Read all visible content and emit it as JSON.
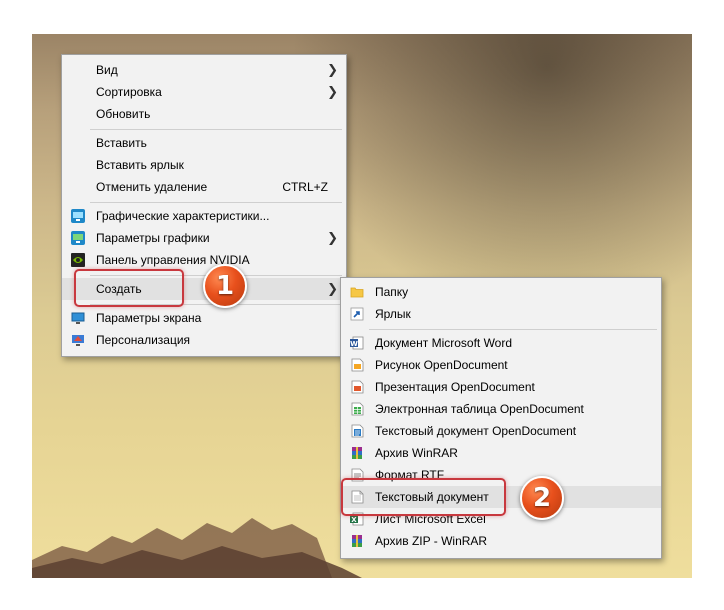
{
  "context_menu": {
    "items": [
      {
        "label": "Вид",
        "has_submenu": true
      },
      {
        "label": "Сортировка",
        "has_submenu": true
      },
      {
        "label": "Обновить"
      },
      {
        "label": "Вставить"
      },
      {
        "label": "Вставить ярлык"
      },
      {
        "label": "Отменить удаление",
        "shortcut": "CTRL+Z"
      },
      {
        "label": "Графические характеристики...",
        "icon": "intel-graphics-icon"
      },
      {
        "label": "Параметры графики",
        "icon": "intel-graphics-icon",
        "has_submenu": true
      },
      {
        "label": "Панель управления NVIDIA",
        "icon": "nvidia-icon"
      },
      {
        "label": "Создать",
        "has_submenu": true,
        "highlighted": true
      },
      {
        "label": "Параметры экрана",
        "icon": "display-icon"
      },
      {
        "label": "Персонализация",
        "icon": "personalization-icon"
      }
    ]
  },
  "submenu_create": {
    "items": [
      {
        "label": "Папку",
        "icon": "folder-icon"
      },
      {
        "label": "Ярлык",
        "icon": "shortcut-icon"
      },
      {
        "label": "Документ Microsoft Word",
        "icon": "word-icon"
      },
      {
        "label": "Рисунок OpenDocument",
        "icon": "odg-icon"
      },
      {
        "label": "Презентация OpenDocument",
        "icon": "odp-icon"
      },
      {
        "label": "Электронная таблица OpenDocument",
        "icon": "ods-icon"
      },
      {
        "label": "Текстовый документ OpenDocument",
        "icon": "odt-icon"
      },
      {
        "label": "Архив WinRAR",
        "icon": "winrar-icon"
      },
      {
        "label": "Формат RTF",
        "icon": "rtf-icon"
      },
      {
        "label": "Текстовый документ",
        "icon": "text-document-icon",
        "highlighted": true
      },
      {
        "label": "Лист Microsoft Excel",
        "icon": "excel-icon"
      },
      {
        "label": "Архив ZIP - WinRAR",
        "icon": "winrar-zip-icon"
      }
    ]
  },
  "annotations": {
    "step1": "1",
    "step2": "2"
  },
  "colors": {
    "menu_background": "#f2f2f2",
    "callout_red": "#c8383e",
    "badge_orange": "#e8501c"
  }
}
